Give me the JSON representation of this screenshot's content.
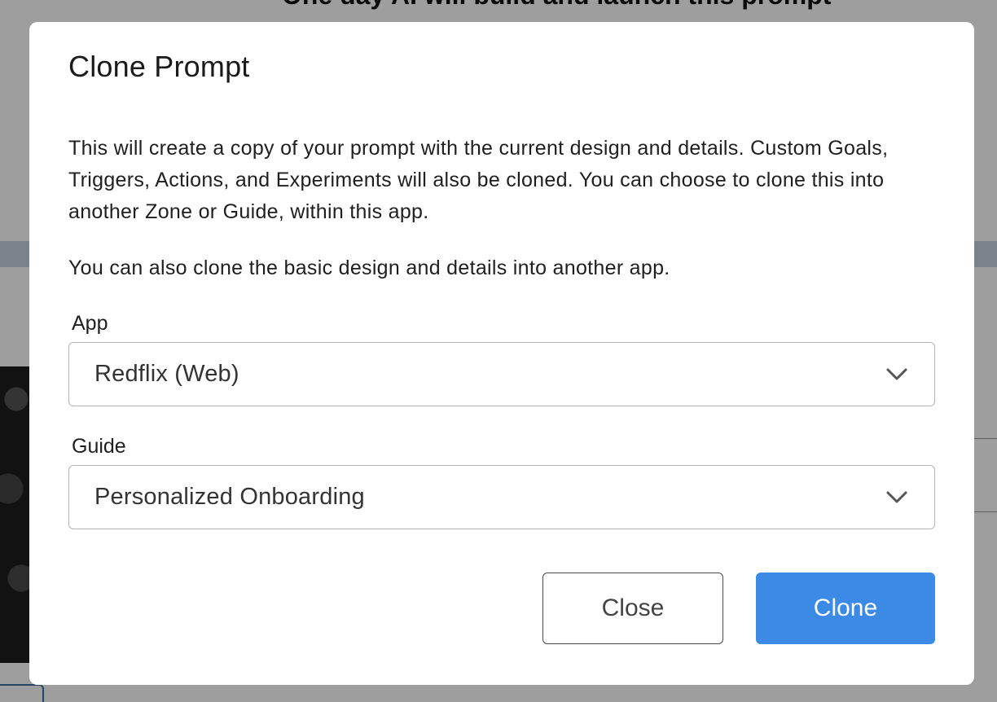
{
  "background": {
    "heading_fragment": "One day AI will build and launch this prompt"
  },
  "modal": {
    "title": "Clone Prompt",
    "description": "This will create a copy of your prompt with the current design and details. Custom Goals, Triggers, Actions, and Experiments will also be cloned. You can choose to clone this into another Zone or Guide, within this app.",
    "description_secondary": "You can also clone the basic design and details into another app.",
    "fields": {
      "app": {
        "label": "App",
        "value": "Redflix (Web)",
        "icon": "chevron-down-icon"
      },
      "guide": {
        "label": "Guide",
        "value": "Personalized Onboarding",
        "icon": "chevron-down-icon"
      }
    },
    "buttons": {
      "close_label": "Close",
      "clone_label": "Clone"
    }
  },
  "colors": {
    "primary": "#3a8ae6",
    "overlay": "rgba(0,0,0,0.38)",
    "border": "#b3b3b3"
  }
}
